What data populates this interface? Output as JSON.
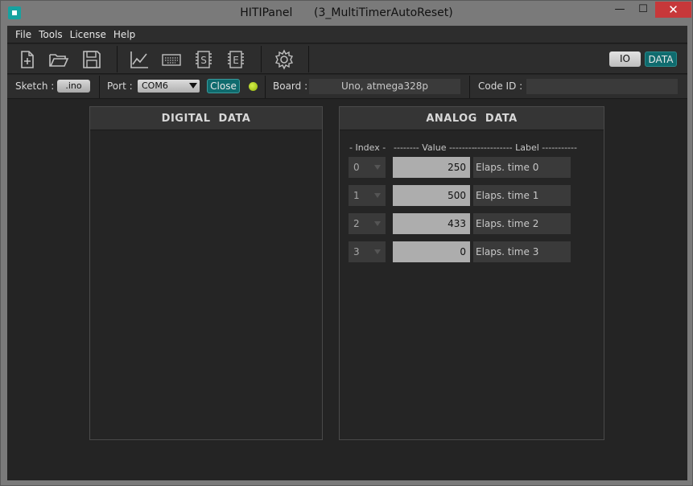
{
  "window": {
    "title": "HITIPanel      (3_MultiTimerAutoReset)",
    "minimize": "—",
    "maximize": "☐",
    "close": "✕"
  },
  "menu": [
    "File",
    "Tools",
    "License",
    "Help"
  ],
  "toolbar": {
    "icons": [
      "new-file-icon",
      "open-folder-icon",
      "save-icon",
      "chart-icon",
      "keyboard-icon",
      "s-chip-icon",
      "e-chip-icon",
      "gear-icon"
    ],
    "io_label": "IO",
    "data_label": "DATA"
  },
  "status": {
    "sketch_label": "Sketch :",
    "sketch_button": ".ino",
    "port_label": "Port :",
    "port_value": "COM6",
    "close_button": "Close",
    "board_label": "Board :",
    "board_value": "Uno, atmega328p",
    "codeid_label": "Code ID :",
    "codeid_value": ""
  },
  "digital": {
    "title": "DIGITAL  DATA"
  },
  "analog": {
    "title": "ANALOG  DATA",
    "col_index": "- Index -",
    "col_value": "-------- Value --------",
    "col_label": "------------ Label -----------",
    "rows": [
      {
        "index": "0",
        "value": "250",
        "label": "Elaps. time 0"
      },
      {
        "index": "1",
        "value": "500",
        "label": "Elaps. time 1"
      },
      {
        "index": "2",
        "value": "433",
        "label": "Elaps. time 2"
      },
      {
        "index": "3",
        "value": "0",
        "label": "Elaps. time 3"
      }
    ]
  },
  "colors": {
    "accent_teal": "#0f6b6e",
    "led_green": "#a8cc12",
    "close_red": "#c7383a"
  }
}
